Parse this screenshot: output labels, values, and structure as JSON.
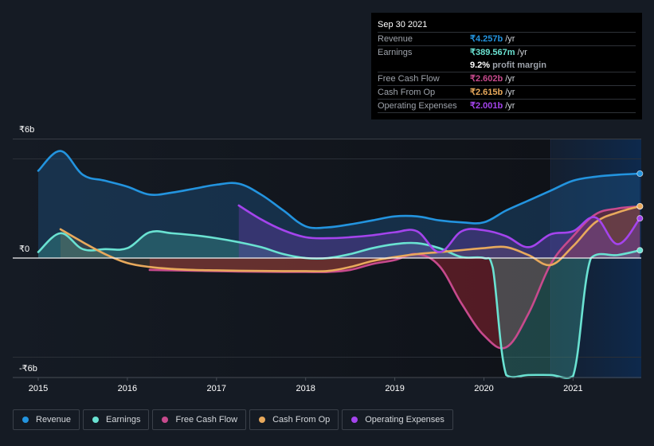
{
  "tooltip": {
    "date": "Sep 30 2021",
    "rows": [
      {
        "label": "Revenue",
        "value": "₹4.257b",
        "unit": "/yr",
        "color": "#2394df"
      },
      {
        "label": "Earnings",
        "value": "₹389.567m",
        "unit": "/yr",
        "color": "#6ae2d2"
      },
      {
        "label": "Free Cash Flow",
        "value": "₹2.602b",
        "unit": "/yr",
        "color": "#c74a8d"
      },
      {
        "label": "Cash From Op",
        "value": "₹2.615b",
        "unit": "/yr",
        "color": "#e8a95c"
      },
      {
        "label": "Operating Expenses",
        "value": "₹2.001b",
        "unit": "/yr",
        "color": "#a444ed"
      }
    ],
    "profit_margin": {
      "value": "9.2%",
      "text": "profit margin"
    }
  },
  "legend": [
    {
      "label": "Revenue",
      "color": "#2394df"
    },
    {
      "label": "Earnings",
      "color": "#6ae2d2"
    },
    {
      "label": "Free Cash Flow",
      "color": "#c74a8d"
    },
    {
      "label": "Cash From Op",
      "color": "#e8a95c"
    },
    {
      "label": "Operating Expenses",
      "color": "#a444ed"
    }
  ],
  "chart_data": {
    "type": "area",
    "title": "",
    "xlabel": "",
    "ylabel": "",
    "y_unit": "₹ billions",
    "ylim": [
      -6,
      6
    ],
    "xlim": [
      2014.9,
      2021.75
    ],
    "y_ticks": [
      {
        "value": 6,
        "label": "₹6b"
      },
      {
        "value": 0,
        "label": "₹0"
      },
      {
        "value": -6,
        "label": "-₹6b"
      }
    ],
    "x_ticks": [
      2015,
      2016,
      2017,
      2018,
      2019,
      2020,
      2021
    ],
    "x_tick_labels": [
      "2015",
      "2016",
      "2017",
      "2018",
      "2019",
      "2020",
      "2021"
    ],
    "highlight_start": 2020.75,
    "series": [
      {
        "name": "Revenue",
        "color": "#2394df",
        "points": [
          [
            2015.0,
            4.4
          ],
          [
            2015.25,
            5.4
          ],
          [
            2015.5,
            4.2
          ],
          [
            2015.75,
            3.9
          ],
          [
            2016.0,
            3.6
          ],
          [
            2016.25,
            3.2
          ],
          [
            2016.5,
            3.3
          ],
          [
            2016.75,
            3.5
          ],
          [
            2017.0,
            3.7
          ],
          [
            2017.25,
            3.75
          ],
          [
            2017.5,
            3.2
          ],
          [
            2017.75,
            2.4
          ],
          [
            2018.0,
            1.6
          ],
          [
            2018.25,
            1.55
          ],
          [
            2018.5,
            1.7
          ],
          [
            2018.75,
            1.9
          ],
          [
            2019.0,
            2.1
          ],
          [
            2019.25,
            2.1
          ],
          [
            2019.5,
            1.9
          ],
          [
            2019.75,
            1.8
          ],
          [
            2020.0,
            1.8
          ],
          [
            2020.25,
            2.4
          ],
          [
            2020.5,
            2.9
          ],
          [
            2020.75,
            3.4
          ],
          [
            2021.0,
            3.9
          ],
          [
            2021.25,
            4.1
          ],
          [
            2021.5,
            4.2
          ],
          [
            2021.75,
            4.257
          ]
        ]
      },
      {
        "name": "Earnings",
        "color": "#6ae2d2",
        "points": [
          [
            2015.0,
            0.3
          ],
          [
            2015.25,
            1.25
          ],
          [
            2015.5,
            0.45
          ],
          [
            2015.75,
            0.45
          ],
          [
            2016.0,
            0.5
          ],
          [
            2016.25,
            1.3
          ],
          [
            2016.5,
            1.25
          ],
          [
            2016.75,
            1.15
          ],
          [
            2017.0,
            1.0
          ],
          [
            2017.25,
            0.8
          ],
          [
            2017.5,
            0.55
          ],
          [
            2017.75,
            0.2
          ],
          [
            2018.0,
            0.0
          ],
          [
            2018.25,
            0.0
          ],
          [
            2018.5,
            0.2
          ],
          [
            2018.75,
            0.5
          ],
          [
            2019.0,
            0.7
          ],
          [
            2019.25,
            0.75
          ],
          [
            2019.5,
            0.5
          ],
          [
            2019.75,
            0.05
          ],
          [
            2020.0,
            0.0
          ],
          [
            2020.1,
            -0.5
          ],
          [
            2020.25,
            -5.9
          ],
          [
            2020.5,
            -5.9
          ],
          [
            2020.75,
            -5.9
          ],
          [
            2021.0,
            -5.95
          ],
          [
            2021.2,
            0.0
          ],
          [
            2021.5,
            0.15
          ],
          [
            2021.75,
            0.39
          ]
        ]
      },
      {
        "name": "Free Cash Flow",
        "color": "#c74a8d",
        "points": [
          [
            2016.25,
            -0.6
          ],
          [
            2016.5,
            -0.62
          ],
          [
            2016.75,
            -0.64
          ],
          [
            2017.0,
            -0.66
          ],
          [
            2017.25,
            -0.68
          ],
          [
            2017.5,
            -0.69
          ],
          [
            2017.75,
            -0.7
          ],
          [
            2018.0,
            -0.7
          ],
          [
            2018.25,
            -0.7
          ],
          [
            2018.5,
            -0.6
          ],
          [
            2018.75,
            -0.3
          ],
          [
            2019.0,
            -0.1
          ],
          [
            2019.25,
            0.2
          ],
          [
            2019.5,
            -0.4
          ],
          [
            2019.75,
            -2.3
          ],
          [
            2020.0,
            -3.9
          ],
          [
            2020.25,
            -4.5
          ],
          [
            2020.5,
            -2.8
          ],
          [
            2020.75,
            -0.3
          ],
          [
            2021.0,
            1.1
          ],
          [
            2021.25,
            2.2
          ],
          [
            2021.5,
            2.5
          ],
          [
            2021.75,
            2.602
          ]
        ]
      },
      {
        "name": "Cash From Op",
        "color": "#e8a95c",
        "points": [
          [
            2015.25,
            1.45
          ],
          [
            2015.5,
            0.8
          ],
          [
            2015.75,
            0.2
          ],
          [
            2016.0,
            -0.25
          ],
          [
            2016.25,
            -0.45
          ],
          [
            2016.5,
            -0.55
          ],
          [
            2016.75,
            -0.6
          ],
          [
            2017.0,
            -0.62
          ],
          [
            2017.25,
            -0.64
          ],
          [
            2017.5,
            -0.65
          ],
          [
            2017.75,
            -0.66
          ],
          [
            2018.0,
            -0.66
          ],
          [
            2018.25,
            -0.65
          ],
          [
            2018.5,
            -0.45
          ],
          [
            2018.75,
            -0.15
          ],
          [
            2019.0,
            0.05
          ],
          [
            2019.25,
            0.2
          ],
          [
            2019.5,
            0.3
          ],
          [
            2019.75,
            0.4
          ],
          [
            2020.0,
            0.5
          ],
          [
            2020.25,
            0.55
          ],
          [
            2020.5,
            0.15
          ],
          [
            2020.75,
            -0.35
          ],
          [
            2021.0,
            0.6
          ],
          [
            2021.25,
            1.8
          ],
          [
            2021.5,
            2.3
          ],
          [
            2021.75,
            2.615
          ]
        ]
      },
      {
        "name": "Operating Expenses",
        "color": "#a444ed",
        "points": [
          [
            2017.25,
            2.65
          ],
          [
            2017.5,
            1.95
          ],
          [
            2017.75,
            1.4
          ],
          [
            2018.0,
            1.05
          ],
          [
            2018.25,
            1.0
          ],
          [
            2018.5,
            1.05
          ],
          [
            2018.75,
            1.15
          ],
          [
            2019.0,
            1.3
          ],
          [
            2019.25,
            1.35
          ],
          [
            2019.5,
            0.3
          ],
          [
            2019.75,
            1.35
          ],
          [
            2020.0,
            1.4
          ],
          [
            2020.25,
            1.1
          ],
          [
            2020.5,
            0.55
          ],
          [
            2020.75,
            1.2
          ],
          [
            2021.0,
            1.35
          ],
          [
            2021.25,
            2.05
          ],
          [
            2021.5,
            0.7
          ],
          [
            2021.75,
            2.001
          ]
        ]
      }
    ],
    "grid": true,
    "legend_position": "bottom-left"
  }
}
